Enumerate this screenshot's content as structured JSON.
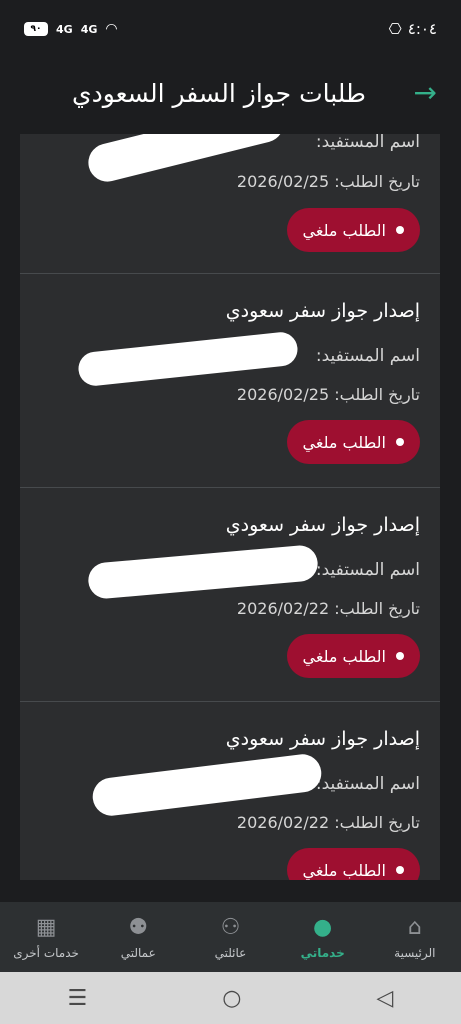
{
  "status": {
    "time": "٤:٠٤",
    "battery": "٩٠",
    "signal1": "4G",
    "signal2": "4G"
  },
  "header": {
    "title": "طلبات جواز السفر السعودي"
  },
  "requests": [
    {
      "title": "",
      "beneficiary": "اسم المستفيد:",
      "date": "تاريخ الطلب: 2026/02/25",
      "status": "الطلب ملغي"
    },
    {
      "title": "إصدار جواز سفر سعودي",
      "beneficiary": "اسم المستفيد:",
      "date": "تاريخ الطلب: 2026/02/25",
      "status": "الطلب ملغي"
    },
    {
      "title": "إصدار جواز سفر سعودي",
      "beneficiary": "اسم المستفيد:",
      "date": "تاريخ الطلب: 2026/02/22",
      "status": "الطلب ملغي"
    },
    {
      "title": "إصدار جواز سفر سعودي",
      "beneficiary": "اسم المستفيد:",
      "date": "تاريخ الطلب: 2026/02/22",
      "status": "الطلب ملغي"
    }
  ],
  "nav": {
    "home": "الرئيسية",
    "my_services": "خدماتي",
    "my_family": "عائلتي",
    "my_workers": "عمالتي",
    "other_services": "خدمات أخرى"
  },
  "colors": {
    "accent": "#34b08a",
    "cancelled": "#9e0f30"
  }
}
